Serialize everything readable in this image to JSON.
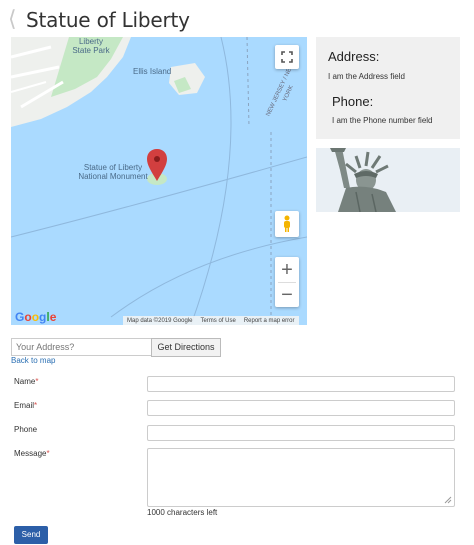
{
  "header": {
    "title": "Statue of Liberty",
    "back_icon": "chevron-left-icon"
  },
  "map": {
    "labels": {
      "liberty_state_park": "Liberty State Park",
      "ellis_island": "Ellis Island",
      "new_jersey_new_york": "NEW JERSEY / NEW YORK",
      "statue_label": "Statue of Liberty National Monument"
    },
    "google": "Google",
    "footer": {
      "data": "Map data ©2019 Google",
      "terms": "Terms of Use",
      "report": "Report a map error"
    },
    "zoom_in": "+",
    "zoom_out": "−",
    "colors": {
      "water": "#aadaff",
      "land": "#eef0ed",
      "park": "#c5e8c5",
      "marker": "#d23f3f"
    }
  },
  "info": {
    "address_heading": "Address:",
    "address_text": "I am the Address field",
    "phone_heading": "Phone:",
    "phone_text": "I am the Phone number field"
  },
  "directions": {
    "placeholder": "Your Address?",
    "button": "Get Directions",
    "back_link": "Back to map"
  },
  "form": {
    "name_label": "Name",
    "email_label": "Email",
    "phone_label": "Phone",
    "message_label": "Message",
    "required_mark": "*",
    "chars_left": "1000 characters left",
    "send": "Send"
  }
}
